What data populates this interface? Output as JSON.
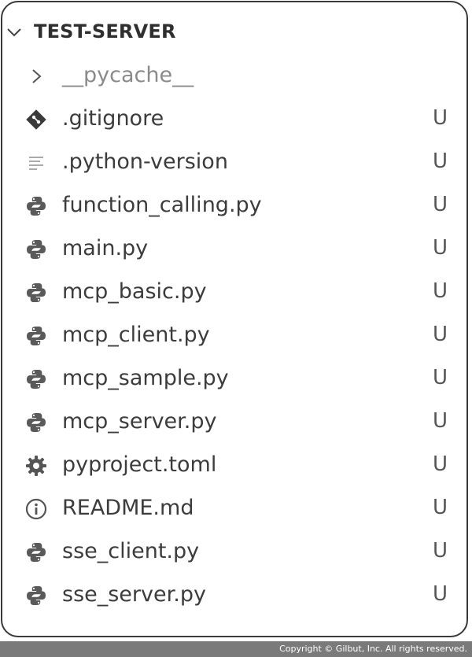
{
  "explorer": {
    "folder_name": "TEST-SERVER",
    "items": [
      {
        "name": "__pycache__",
        "status": "",
        "icon": "chevron-right-icon"
      },
      {
        "name": ".gitignore",
        "status": "U",
        "icon": "git-icon"
      },
      {
        "name": ".python-version",
        "status": "U",
        "icon": "text-lines-icon"
      },
      {
        "name": "function_calling.py",
        "status": "U",
        "icon": "python-icon"
      },
      {
        "name": "main.py",
        "status": "U",
        "icon": "python-icon"
      },
      {
        "name": "mcp_basic.py",
        "status": "U",
        "icon": "python-icon"
      },
      {
        "name": "mcp_client.py",
        "status": "U",
        "icon": "python-icon"
      },
      {
        "name": "mcp_sample.py",
        "status": "U",
        "icon": "python-icon"
      },
      {
        "name": "mcp_server.py",
        "status": "U",
        "icon": "python-icon"
      },
      {
        "name": "pyproject.toml",
        "status": "U",
        "icon": "gear-icon"
      },
      {
        "name": "README.md",
        "status": "U",
        "icon": "info-icon"
      },
      {
        "name": "sse_client.py",
        "status": "U",
        "icon": "python-icon"
      },
      {
        "name": "sse_server.py",
        "status": "U",
        "icon": "python-icon"
      }
    ]
  },
  "footer": {
    "copyright": "Copyright © Gilbut, Inc. All rights reserved."
  }
}
